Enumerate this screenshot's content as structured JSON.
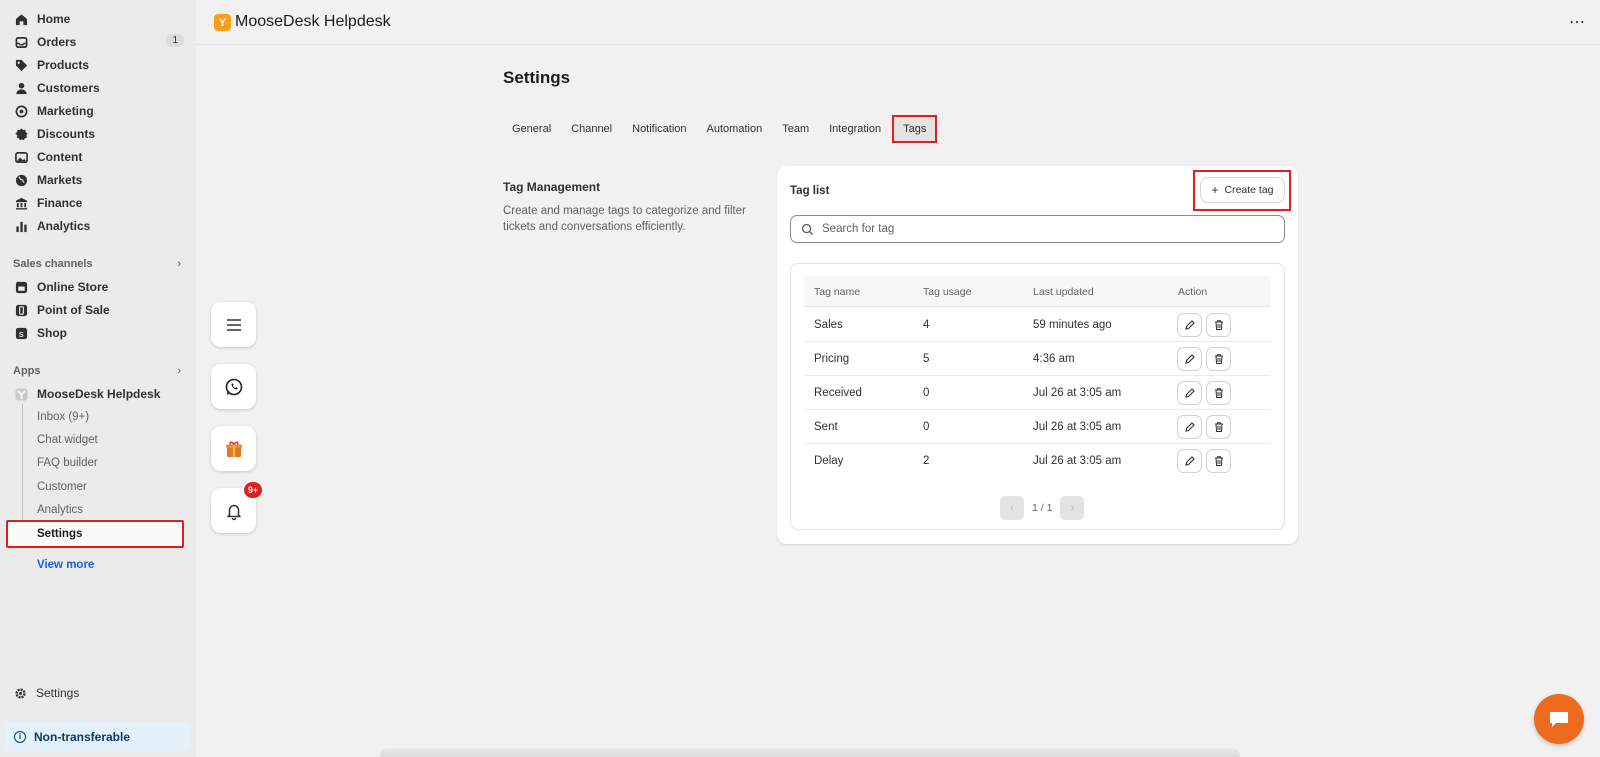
{
  "sidebar": {
    "nav": [
      {
        "label": "Home",
        "icon": "home-icon"
      },
      {
        "label": "Orders",
        "icon": "orders-icon",
        "badge": "1"
      },
      {
        "label": "Products",
        "icon": "tag-icon"
      },
      {
        "label": "Customers",
        "icon": "person-icon"
      },
      {
        "label": "Marketing",
        "icon": "target-icon"
      },
      {
        "label": "Discounts",
        "icon": "discount-icon"
      },
      {
        "label": "Content",
        "icon": "image-icon"
      },
      {
        "label": "Markets",
        "icon": "globe-icon"
      },
      {
        "label": "Finance",
        "icon": "bank-icon"
      },
      {
        "label": "Analytics",
        "icon": "bar-chart-icon"
      }
    ],
    "sales_channels_label": "Sales channels",
    "channels": [
      {
        "label": "Online Store",
        "icon": "store-icon"
      },
      {
        "label": "Point of Sale",
        "icon": "pos-icon"
      },
      {
        "label": "Shop",
        "icon": "shop-icon"
      }
    ],
    "apps_label": "Apps",
    "app_name": "MooseDesk Helpdesk",
    "app_subitems": [
      "Inbox (9+)",
      "Chat widget",
      "FAQ builder",
      "Customer",
      "Analytics",
      "Settings"
    ],
    "view_more": "View more",
    "footer_settings": "Settings",
    "non_transferable": "Non-transferable"
  },
  "header": {
    "app_title": "MooseDesk Helpdesk",
    "logo_letter": "Y",
    "more": "⋯"
  },
  "floating": {
    "notif_badge": "9+"
  },
  "main": {
    "title": "Settings",
    "tabs": [
      "General",
      "Channel",
      "Notification",
      "Automation",
      "Team",
      "Integration",
      "Tags"
    ],
    "active_tab": "Tags",
    "section_title": "Tag Management",
    "section_desc": "Create and manage tags to categorize and filter tickets and conversations efficiently.",
    "card": {
      "title": "Tag list",
      "create_label": "Create tag",
      "search_placeholder": "Search for tag",
      "columns": [
        "Tag name",
        "Tag usage",
        "Last updated",
        "Action"
      ],
      "rows": [
        {
          "name": "Sales",
          "usage": "4",
          "updated": "59 minutes ago"
        },
        {
          "name": "Pricing",
          "usage": "5",
          "updated": "4:36 am"
        },
        {
          "name": "Received",
          "usage": "0",
          "updated": "Jul 26 at 3:05 am"
        },
        {
          "name": "Sent",
          "usage": "0",
          "updated": "Jul 26 at 3:05 am"
        },
        {
          "name": "Delay",
          "usage": "2",
          "updated": "Jul 26 at 3:05 am"
        }
      ],
      "pagination": "1 / 1"
    }
  },
  "colors": {
    "highlight": "#e02020",
    "link": "#1a5fd6",
    "brand_orange": "#ec6b1f"
  }
}
